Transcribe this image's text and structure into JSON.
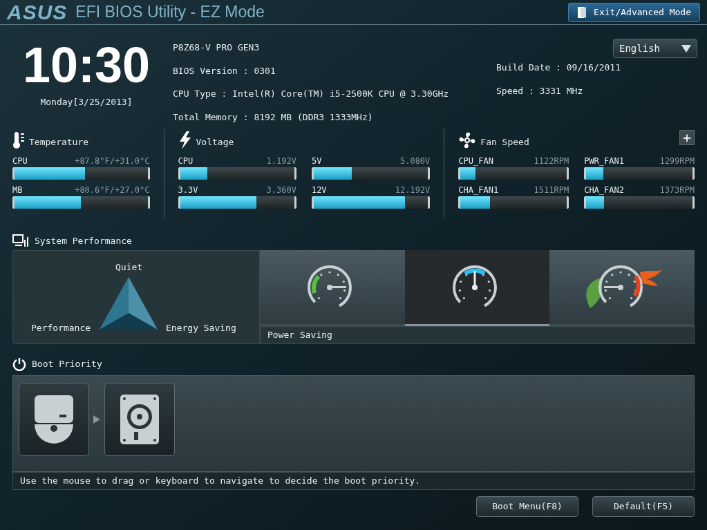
{
  "header": {
    "logo": "ASUS",
    "title": "EFI BIOS Utility - EZ Mode",
    "exit_button": "Exit/Advanced Mode"
  },
  "clock": {
    "time": "10:30",
    "date": "Monday[3/25/2013]"
  },
  "info": {
    "left": [
      "P8Z68-V PRO GEN3",
      "BIOS Version : 0301",
      "CPU Type : Intel(R) Core(TM) i5-2500K CPU @ 3.30GHz",
      "Total Memory : 8192 MB (DDR3 1333MHz)"
    ],
    "right": [
      "Build Date : 09/16/2011",
      "Speed : 3331 MHz"
    ]
  },
  "language": "English",
  "monitors": [
    {
      "kind": "temperature",
      "title": "Temperature",
      "items": [
        {
          "name": "CPU",
          "reading": "+87.8°F/+31.0°C",
          "level": 0.53
        },
        {
          "name": "MB",
          "reading": "+80.6°F/+27.0°C",
          "level": 0.5
        }
      ]
    },
    {
      "kind": "voltage",
      "title": "Voltage",
      "items": [
        {
          "name": "CPU",
          "reading": "1.192V",
          "level": 0.24
        },
        {
          "name": "5V",
          "reading": "5.080V",
          "level": 0.33
        },
        {
          "name": "3.3V",
          "reading": "3.360V",
          "level": 0.67
        },
        {
          "name": "12V",
          "reading": "12.192V",
          "level": 0.8
        }
      ]
    },
    {
      "kind": "fan",
      "title": "Fan Speed",
      "expand": "+",
      "items": [
        {
          "name": "CPU_FAN",
          "reading": "1122RPM",
          "level": 0.14
        },
        {
          "name": "PWR_FAN1",
          "reading": "1299RPM",
          "level": 0.16
        },
        {
          "name": "CHA_FAN1",
          "reading": "1511RPM",
          "level": 0.28
        },
        {
          "name": "CHA_FAN2",
          "reading": "1373RPM",
          "level": 0.17
        }
      ]
    }
  ],
  "performance": {
    "title": "System Performance",
    "triangle": {
      "top": "Quiet",
      "left": "Performance",
      "right": "Energy Saving"
    },
    "modes": [
      {
        "kind": "power-saving",
        "selected": false
      },
      {
        "kind": "normal",
        "selected": true
      },
      {
        "kind": "asus-optimal",
        "selected": false
      }
    ],
    "hover_label": "Power Saving"
  },
  "boot": {
    "title": "Boot Priority",
    "devices": [
      {
        "kind": "optical"
      },
      {
        "kind": "hdd"
      }
    ],
    "hint": "Use the mouse to drag or keyboard to navigate to decide the boot priority."
  },
  "buttons": [
    "Boot Menu(F8)",
    "Default(F5)"
  ]
}
